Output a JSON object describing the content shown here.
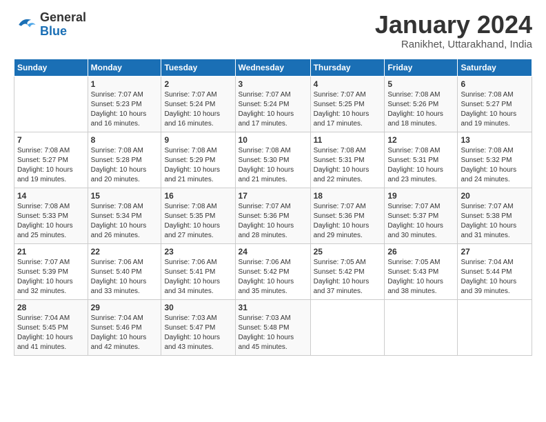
{
  "logo": {
    "general": "General",
    "blue": "Blue"
  },
  "title": "January 2024",
  "subtitle": "Ranikhet, Uttarakhand, India",
  "days_of_week": [
    "Sunday",
    "Monday",
    "Tuesday",
    "Wednesday",
    "Thursday",
    "Friday",
    "Saturday"
  ],
  "weeks": [
    [
      {
        "num": "",
        "info": ""
      },
      {
        "num": "1",
        "info": "Sunrise: 7:07 AM\nSunset: 5:23 PM\nDaylight: 10 hours\nand 16 minutes."
      },
      {
        "num": "2",
        "info": "Sunrise: 7:07 AM\nSunset: 5:24 PM\nDaylight: 10 hours\nand 16 minutes."
      },
      {
        "num": "3",
        "info": "Sunrise: 7:07 AM\nSunset: 5:24 PM\nDaylight: 10 hours\nand 17 minutes."
      },
      {
        "num": "4",
        "info": "Sunrise: 7:07 AM\nSunset: 5:25 PM\nDaylight: 10 hours\nand 17 minutes."
      },
      {
        "num": "5",
        "info": "Sunrise: 7:08 AM\nSunset: 5:26 PM\nDaylight: 10 hours\nand 18 minutes."
      },
      {
        "num": "6",
        "info": "Sunrise: 7:08 AM\nSunset: 5:27 PM\nDaylight: 10 hours\nand 19 minutes."
      }
    ],
    [
      {
        "num": "7",
        "info": "Sunrise: 7:08 AM\nSunset: 5:27 PM\nDaylight: 10 hours\nand 19 minutes."
      },
      {
        "num": "8",
        "info": "Sunrise: 7:08 AM\nSunset: 5:28 PM\nDaylight: 10 hours\nand 20 minutes."
      },
      {
        "num": "9",
        "info": "Sunrise: 7:08 AM\nSunset: 5:29 PM\nDaylight: 10 hours\nand 21 minutes."
      },
      {
        "num": "10",
        "info": "Sunrise: 7:08 AM\nSunset: 5:30 PM\nDaylight: 10 hours\nand 21 minutes."
      },
      {
        "num": "11",
        "info": "Sunrise: 7:08 AM\nSunset: 5:31 PM\nDaylight: 10 hours\nand 22 minutes."
      },
      {
        "num": "12",
        "info": "Sunrise: 7:08 AM\nSunset: 5:31 PM\nDaylight: 10 hours\nand 23 minutes."
      },
      {
        "num": "13",
        "info": "Sunrise: 7:08 AM\nSunset: 5:32 PM\nDaylight: 10 hours\nand 24 minutes."
      }
    ],
    [
      {
        "num": "14",
        "info": "Sunrise: 7:08 AM\nSunset: 5:33 PM\nDaylight: 10 hours\nand 25 minutes."
      },
      {
        "num": "15",
        "info": "Sunrise: 7:08 AM\nSunset: 5:34 PM\nDaylight: 10 hours\nand 26 minutes."
      },
      {
        "num": "16",
        "info": "Sunrise: 7:08 AM\nSunset: 5:35 PM\nDaylight: 10 hours\nand 27 minutes."
      },
      {
        "num": "17",
        "info": "Sunrise: 7:07 AM\nSunset: 5:36 PM\nDaylight: 10 hours\nand 28 minutes."
      },
      {
        "num": "18",
        "info": "Sunrise: 7:07 AM\nSunset: 5:36 PM\nDaylight: 10 hours\nand 29 minutes."
      },
      {
        "num": "19",
        "info": "Sunrise: 7:07 AM\nSunset: 5:37 PM\nDaylight: 10 hours\nand 30 minutes."
      },
      {
        "num": "20",
        "info": "Sunrise: 7:07 AM\nSunset: 5:38 PM\nDaylight: 10 hours\nand 31 minutes."
      }
    ],
    [
      {
        "num": "21",
        "info": "Sunrise: 7:07 AM\nSunset: 5:39 PM\nDaylight: 10 hours\nand 32 minutes."
      },
      {
        "num": "22",
        "info": "Sunrise: 7:06 AM\nSunset: 5:40 PM\nDaylight: 10 hours\nand 33 minutes."
      },
      {
        "num": "23",
        "info": "Sunrise: 7:06 AM\nSunset: 5:41 PM\nDaylight: 10 hours\nand 34 minutes."
      },
      {
        "num": "24",
        "info": "Sunrise: 7:06 AM\nSunset: 5:42 PM\nDaylight: 10 hours\nand 35 minutes."
      },
      {
        "num": "25",
        "info": "Sunrise: 7:05 AM\nSunset: 5:42 PM\nDaylight: 10 hours\nand 37 minutes."
      },
      {
        "num": "26",
        "info": "Sunrise: 7:05 AM\nSunset: 5:43 PM\nDaylight: 10 hours\nand 38 minutes."
      },
      {
        "num": "27",
        "info": "Sunrise: 7:04 AM\nSunset: 5:44 PM\nDaylight: 10 hours\nand 39 minutes."
      }
    ],
    [
      {
        "num": "28",
        "info": "Sunrise: 7:04 AM\nSunset: 5:45 PM\nDaylight: 10 hours\nand 41 minutes."
      },
      {
        "num": "29",
        "info": "Sunrise: 7:04 AM\nSunset: 5:46 PM\nDaylight: 10 hours\nand 42 minutes."
      },
      {
        "num": "30",
        "info": "Sunrise: 7:03 AM\nSunset: 5:47 PM\nDaylight: 10 hours\nand 43 minutes."
      },
      {
        "num": "31",
        "info": "Sunrise: 7:03 AM\nSunset: 5:48 PM\nDaylight: 10 hours\nand 45 minutes."
      },
      {
        "num": "",
        "info": ""
      },
      {
        "num": "",
        "info": ""
      },
      {
        "num": "",
        "info": ""
      }
    ]
  ]
}
